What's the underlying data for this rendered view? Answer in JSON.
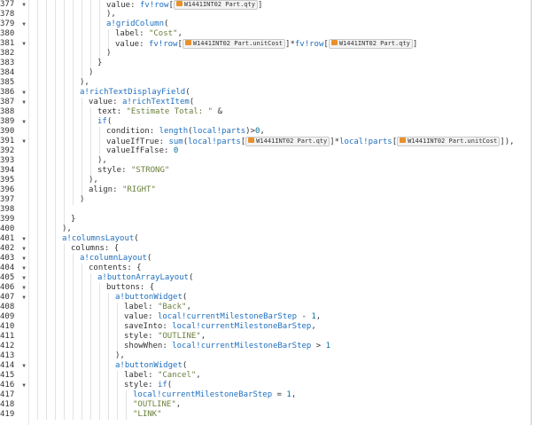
{
  "editor": {
    "lines": [
      {
        "n": "377",
        "fold": true,
        "depth": 9,
        "parts": [
          [
            "p",
            "value: "
          ],
          [
            "k",
            "fv!row"
          ],
          [
            "p",
            "["
          ],
          [
            "c",
            "W1441INT02 Part.qty"
          ],
          [
            "p",
            "]"
          ]
        ]
      },
      {
        "n": "378",
        "fold": false,
        "depth": 9,
        "parts": [
          [
            "p",
            "),"
          ]
        ]
      },
      {
        "n": "379",
        "fold": true,
        "depth": 9,
        "parts": [
          [
            "k",
            "a!gridColumn"
          ],
          [
            "p",
            "("
          ]
        ]
      },
      {
        "n": "380",
        "fold": false,
        "depth": 10,
        "parts": [
          [
            "p",
            "label: "
          ],
          [
            "s",
            "\"Cost\""
          ],
          [
            "p",
            ","
          ]
        ]
      },
      {
        "n": "381",
        "fold": true,
        "depth": 10,
        "parts": [
          [
            "p",
            "value: "
          ],
          [
            "k",
            "fv!row"
          ],
          [
            "p",
            "["
          ],
          [
            "c",
            "W1441INT02 Part.unitCost"
          ],
          [
            "p",
            "]*"
          ],
          [
            "k",
            "fv!row"
          ],
          [
            "p",
            "["
          ],
          [
            "c",
            "W1441INT02 Part.qty"
          ],
          [
            "p",
            "]"
          ]
        ]
      },
      {
        "n": "382",
        "fold": false,
        "depth": 9,
        "parts": [
          [
            "p",
            ")"
          ]
        ]
      },
      {
        "n": "383",
        "fold": false,
        "depth": 8,
        "parts": [
          [
            "p",
            "}"
          ]
        ]
      },
      {
        "n": "384",
        "fold": false,
        "depth": 7,
        "parts": [
          [
            "p",
            ")"
          ]
        ]
      },
      {
        "n": "385",
        "fold": false,
        "depth": 6,
        "parts": [
          [
            "p",
            "),"
          ]
        ]
      },
      {
        "n": "386",
        "fold": true,
        "depth": 6,
        "parts": [
          [
            "k",
            "a!richTextDisplayField"
          ],
          [
            "p",
            "("
          ]
        ]
      },
      {
        "n": "387",
        "fold": true,
        "depth": 7,
        "parts": [
          [
            "p",
            "value: "
          ],
          [
            "k",
            "a!richTextItem"
          ],
          [
            "p",
            "("
          ]
        ]
      },
      {
        "n": "388",
        "fold": false,
        "depth": 8,
        "parts": [
          [
            "p",
            "text: "
          ],
          [
            "s",
            "\"Estimate Total: \""
          ],
          [
            "p",
            " &"
          ]
        ]
      },
      {
        "n": "389",
        "fold": true,
        "depth": 8,
        "parts": [
          [
            "k",
            "if"
          ],
          [
            "p",
            "("
          ]
        ]
      },
      {
        "n": "390",
        "fold": false,
        "depth": 9,
        "parts": [
          [
            "p",
            "condition: "
          ],
          [
            "k",
            "length"
          ],
          [
            "p",
            "("
          ],
          [
            "k",
            "local!parts"
          ],
          [
            "p",
            ")>"
          ],
          [
            "n",
            "0"
          ],
          [
            "p",
            ","
          ]
        ]
      },
      {
        "n": "391",
        "fold": true,
        "depth": 9,
        "parts": [
          [
            "p",
            "valueIfTrue: "
          ],
          [
            "k",
            "sum"
          ],
          [
            "p",
            "("
          ],
          [
            "k",
            "local!parts"
          ],
          [
            "p",
            "["
          ],
          [
            "c",
            "W1441INT02 Part.qty"
          ],
          [
            "p",
            "]*"
          ],
          [
            "k",
            "local!parts"
          ],
          [
            "p",
            "["
          ],
          [
            "c",
            "W1441INT02 Part.unitCost"
          ],
          [
            "p",
            "]),"
          ]
        ]
      },
      {
        "n": "392",
        "fold": false,
        "depth": 9,
        "parts": [
          [
            "p",
            "valueIfFalse: "
          ],
          [
            "n",
            "0"
          ]
        ]
      },
      {
        "n": "393",
        "fold": false,
        "depth": 8,
        "parts": [
          [
            "p",
            "),"
          ]
        ]
      },
      {
        "n": "394",
        "fold": false,
        "depth": 8,
        "parts": [
          [
            "p",
            "style: "
          ],
          [
            "s",
            "\"STRONG\""
          ]
        ]
      },
      {
        "n": "395",
        "fold": false,
        "depth": 7,
        "parts": [
          [
            "p",
            "),"
          ]
        ]
      },
      {
        "n": "396",
        "fold": false,
        "depth": 7,
        "parts": [
          [
            "p",
            "align: "
          ],
          [
            "s",
            "\"RIGHT\""
          ]
        ]
      },
      {
        "n": "397",
        "fold": false,
        "depth": 6,
        "parts": [
          [
            "p",
            ")"
          ]
        ]
      },
      {
        "n": "398",
        "fold": false,
        "depth": 5,
        "parts": []
      },
      {
        "n": "399",
        "fold": false,
        "depth": 5,
        "parts": [
          [
            "p",
            "}"
          ]
        ]
      },
      {
        "n": "400",
        "fold": false,
        "depth": 4,
        "parts": [
          [
            "p",
            "),"
          ]
        ]
      },
      {
        "n": "401",
        "fold": true,
        "depth": 4,
        "parts": [
          [
            "k",
            "a!columnsLayout"
          ],
          [
            "p",
            "("
          ]
        ]
      },
      {
        "n": "402",
        "fold": true,
        "depth": 5,
        "parts": [
          [
            "p",
            "columns: {"
          ]
        ]
      },
      {
        "n": "403",
        "fold": true,
        "depth": 6,
        "parts": [
          [
            "k",
            "a!columnLayout"
          ],
          [
            "p",
            "("
          ]
        ]
      },
      {
        "n": "404",
        "fold": true,
        "depth": 7,
        "parts": [
          [
            "p",
            "contents: {"
          ]
        ]
      },
      {
        "n": "405",
        "fold": true,
        "depth": 8,
        "parts": [
          [
            "k",
            "a!buttonArrayLayout"
          ],
          [
            "p",
            "("
          ]
        ]
      },
      {
        "n": "406",
        "fold": true,
        "depth": 9,
        "parts": [
          [
            "p",
            "buttons: {"
          ]
        ]
      },
      {
        "n": "407",
        "fold": true,
        "depth": 10,
        "parts": [
          [
            "k",
            "a!buttonWidget"
          ],
          [
            "p",
            "("
          ]
        ]
      },
      {
        "n": "408",
        "fold": false,
        "depth": 11,
        "parts": [
          [
            "p",
            "label: "
          ],
          [
            "s",
            "\"Back\""
          ],
          [
            "p",
            ","
          ]
        ]
      },
      {
        "n": "409",
        "fold": false,
        "depth": 11,
        "parts": [
          [
            "p",
            "value: "
          ],
          [
            "k",
            "local!currentMilestoneBarStep"
          ],
          [
            "p",
            " - "
          ],
          [
            "n",
            "1"
          ],
          [
            "p",
            ","
          ]
        ]
      },
      {
        "n": "410",
        "fold": false,
        "depth": 11,
        "parts": [
          [
            "p",
            "saveInto: "
          ],
          [
            "k",
            "local!currentMilestoneBarStep"
          ],
          [
            "p",
            ","
          ]
        ]
      },
      {
        "n": "411",
        "fold": false,
        "depth": 11,
        "parts": [
          [
            "p",
            "style: "
          ],
          [
            "s",
            "\"OUTLINE\""
          ],
          [
            "p",
            ","
          ]
        ]
      },
      {
        "n": "412",
        "fold": false,
        "depth": 11,
        "parts": [
          [
            "p",
            "showWhen: "
          ],
          [
            "k",
            "local!currentMilestoneBarStep"
          ],
          [
            "p",
            " > "
          ],
          [
            "n",
            "1"
          ]
        ]
      },
      {
        "n": "413",
        "fold": false,
        "depth": 10,
        "parts": [
          [
            "p",
            "),"
          ]
        ]
      },
      {
        "n": "414",
        "fold": true,
        "depth": 10,
        "parts": [
          [
            "k",
            "a!buttonWidget"
          ],
          [
            "p",
            "("
          ]
        ]
      },
      {
        "n": "415",
        "fold": false,
        "depth": 11,
        "parts": [
          [
            "p",
            "label: "
          ],
          [
            "s",
            "\"Cancel\""
          ],
          [
            "p",
            ","
          ]
        ]
      },
      {
        "n": "416",
        "fold": true,
        "depth": 11,
        "parts": [
          [
            "p",
            "style: "
          ],
          [
            "k",
            "if"
          ],
          [
            "p",
            "("
          ]
        ]
      },
      {
        "n": "417",
        "fold": false,
        "depth": 12,
        "parts": [
          [
            "k",
            "local!currentMilestoneBarStep"
          ],
          [
            "p",
            " = "
          ],
          [
            "n",
            "1"
          ],
          [
            "p",
            ","
          ]
        ]
      },
      {
        "n": "418",
        "fold": false,
        "depth": 12,
        "parts": [
          [
            "s",
            "\"OUTLINE\""
          ],
          [
            "p",
            ","
          ]
        ]
      },
      {
        "n": "419",
        "fold": false,
        "depth": 12,
        "parts": [
          [
            "s",
            "\"LINK\""
          ]
        ]
      }
    ]
  }
}
